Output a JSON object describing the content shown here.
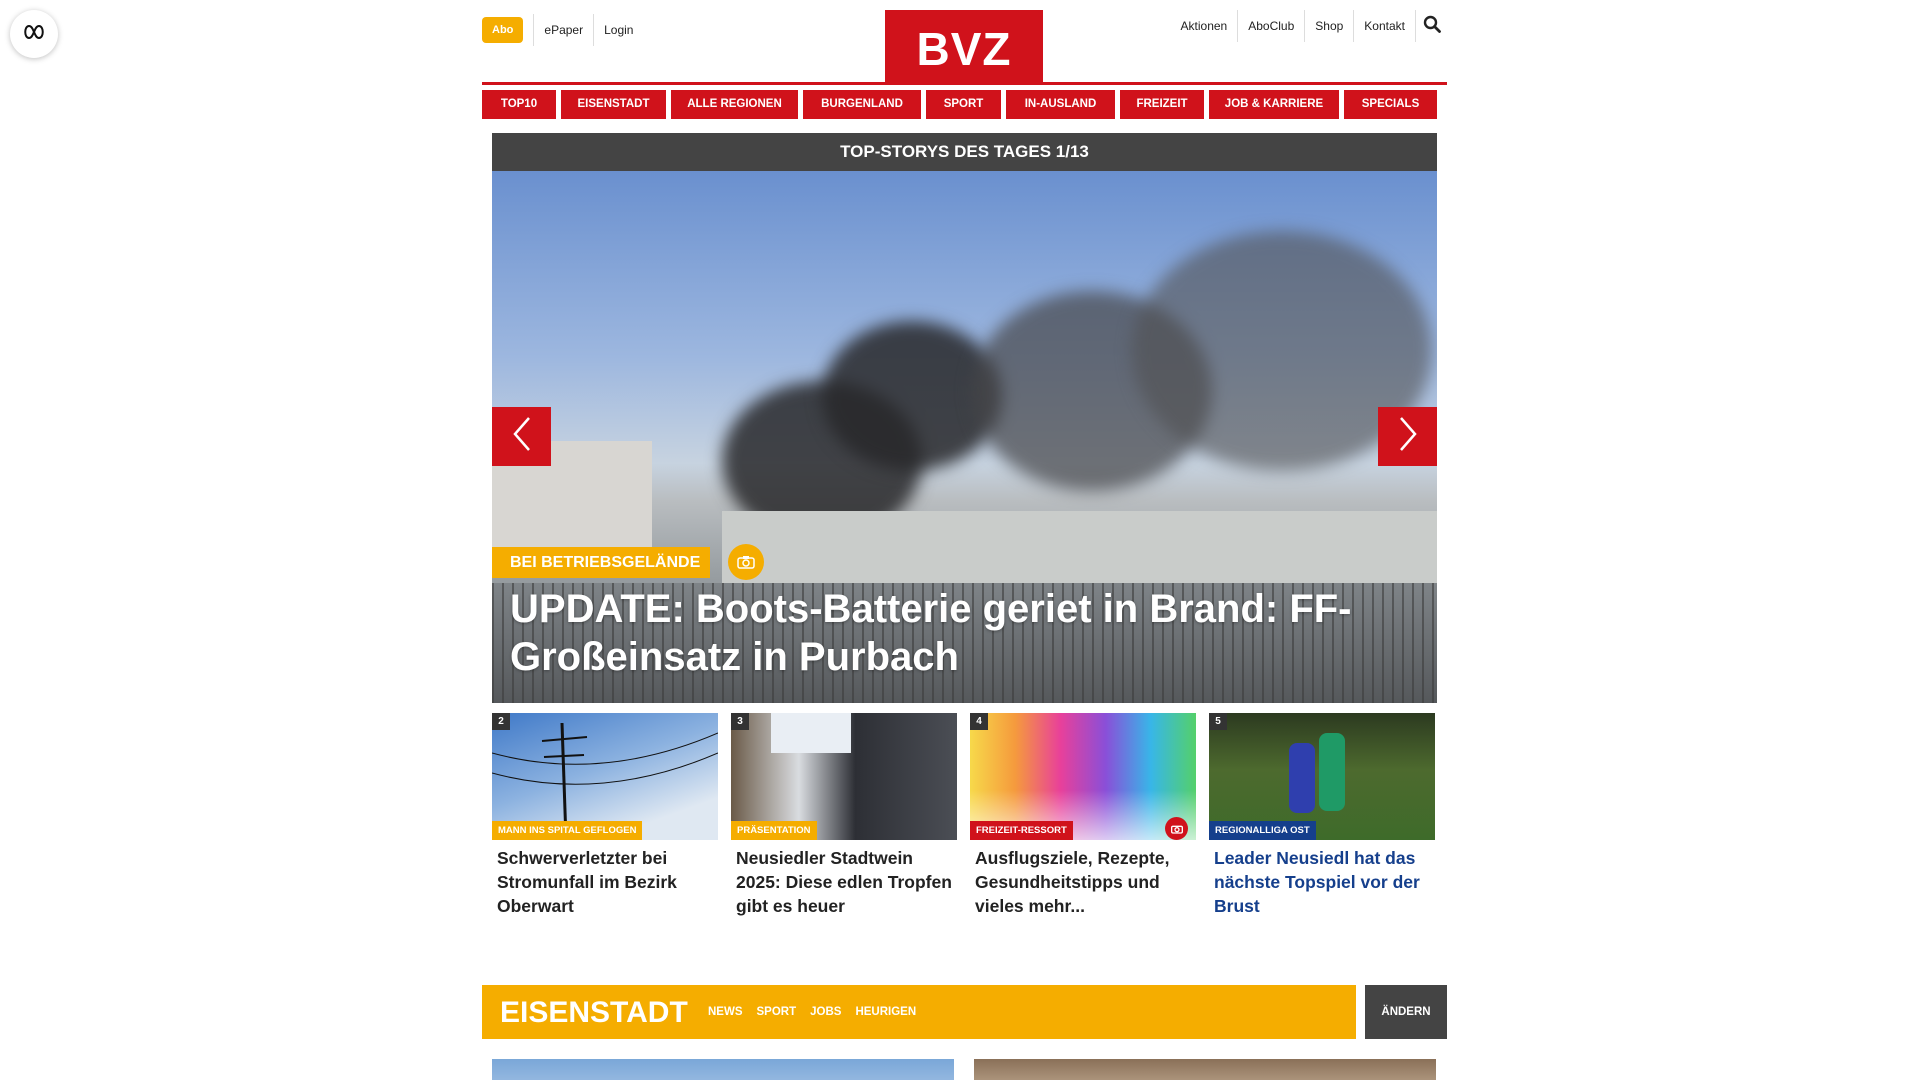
{
  "header": {
    "abo": "Abo",
    "left_links": [
      "ePaper",
      "Login"
    ],
    "logo": "BVZ",
    "right_links": [
      "Aktionen",
      "AboClub",
      "Shop",
      "Kontakt"
    ]
  },
  "nav": [
    "TOP10",
    "EISENSTADT",
    "ALLE REGIONEN",
    "BURGENLAND",
    "SPORT",
    "IN-AUSLAND",
    "FREIZEIT",
    "JOB & KARRIERE",
    "SPECIALS"
  ],
  "hero": {
    "heading": "TOP-STORYS DES TAGES 1/13",
    "kicker": "BEI BETRIEBSGELÄNDE",
    "title": "UPDATE: Boots-Batterie geriet in Brand: FF-Großeinsatz in Purbach"
  },
  "teasers": [
    {
      "num": "2",
      "kicker": "MANN INS SPITAL GEFLOGEN",
      "title": "Schwerverletzter bei Stromunfall im Bezirk Oberwart"
    },
    {
      "num": "3",
      "kicker": "PRÄSENTATION",
      "title": "Neusiedler Stadtwein 2025: Diese edlen Tropfen gibt es heuer"
    },
    {
      "num": "4",
      "kicker": "FREIZEIT-RESSORT",
      "title": "Ausflugsziele, Rezepte, Gesundheitstipps und vieles mehr..."
    },
    {
      "num": "5",
      "kicker": "REGIONALLIGA OST",
      "title": "Leader Neusiedl hat das nächste Topspiel vor der Brust"
    }
  ],
  "region": {
    "name": "EISENSTADT",
    "links": [
      "NEWS",
      "SPORT",
      "JOBS",
      "HEURIGEN"
    ],
    "change": "ÄNDERN"
  },
  "colors": {
    "brand_red": "#d0121b",
    "accent_yellow": "#f5ad00",
    "dark_gray": "#444444",
    "link_blue": "#153f8c"
  },
  "icons": [
    "accessibility-icon",
    "search-icon",
    "chevron-left-icon",
    "chevron-right-icon",
    "camera-icon"
  ]
}
